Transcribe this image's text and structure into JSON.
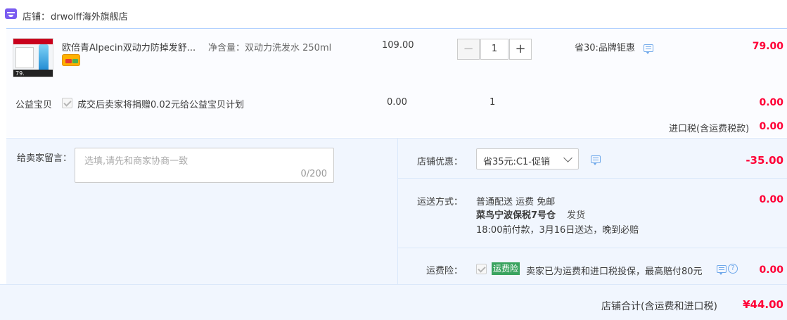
{
  "shop": {
    "label": "店铺：",
    "name": "drwolff海外旗舰店"
  },
  "item": {
    "title": "欧倍青Alpecin双动力防掉发舒...",
    "spec": "净含量：双动力洗发水 250ml",
    "price": "109.00",
    "quantity": "1",
    "discount": "省30:品牌钜惠",
    "subtotal": "79.00",
    "thumb_price": "79."
  },
  "charity": {
    "label": "公益宝贝",
    "text": "成交后卖家将捐赠0.02元给公益宝贝计划",
    "price": "0.00",
    "quantity": "1",
    "subtotal": "0.00"
  },
  "import_tax": {
    "label": "进口税(含运费税款)",
    "value": "0.00"
  },
  "message": {
    "label": "给卖家留言：",
    "placeholder": "选填,请先和商家协商一致",
    "counter": "0/200"
  },
  "shop_discount": {
    "label": "店铺优惠：",
    "selected": "省35元:C1-促销",
    "value": "-35.00"
  },
  "shipping": {
    "label": "运送方式：",
    "line1": "普通配送 运费 免邮",
    "warehouse": "菜鸟宁波保税7号仓",
    "ship_text": "发货",
    "line3": "18:00前付款，3月16日送达，晚到必赔",
    "value": "0.00"
  },
  "insurance": {
    "label": "运费险：",
    "badge": "运费险",
    "text": "卖家已为运费和进口税投保，最高赔付80元",
    "value": "0.00"
  },
  "total": {
    "label": "店铺合计(含运费和进口税)",
    "value": "¥44.00"
  },
  "colors": {
    "accent_red": "#ff0036",
    "badge_green": "#3aa35f",
    "link_blue": "#6fa8ea"
  }
}
